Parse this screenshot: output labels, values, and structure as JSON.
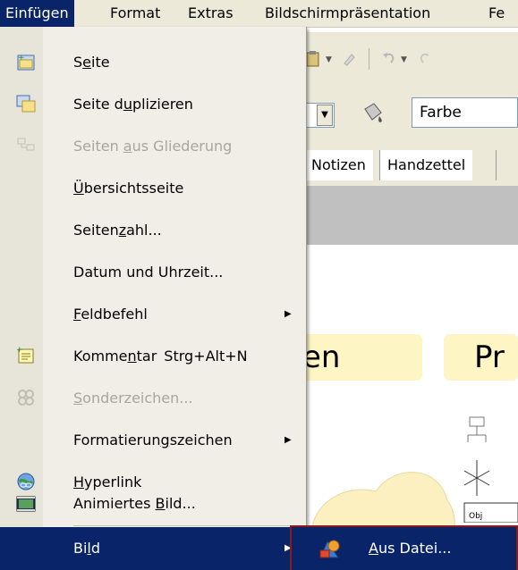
{
  "menubar": {
    "items": [
      {
        "label": "Einfügen",
        "mnemonic": "E"
      },
      {
        "label": "Format",
        "mnemonic": "F"
      },
      {
        "label": "Extras",
        "mnemonic": "x"
      },
      {
        "label": "Bildschirmpräsentation",
        "mnemonic": "p"
      },
      {
        "label": "Fe",
        "mnemonic": ""
      }
    ]
  },
  "menu": {
    "items": [
      {
        "label": "Seite",
        "icon": "new-slide-icon",
        "enabled": true,
        "submenu": false
      },
      {
        "label": "Seite duplizieren",
        "icon": "duplicate-slide-icon",
        "enabled": true,
        "submenu": false
      },
      {
        "label": "Seiten aus Gliederung",
        "icon": "outline-slides-icon",
        "enabled": false,
        "submenu": false
      },
      {
        "label": "Übersichtsseite",
        "icon": "",
        "enabled": true,
        "submenu": false
      },
      {
        "label": "Seitenzahl...",
        "icon": "",
        "enabled": true,
        "submenu": false
      },
      {
        "label": "Datum und Uhrzeit...",
        "icon": "",
        "enabled": true,
        "submenu": false
      },
      {
        "label": "Feldbefehl",
        "icon": "",
        "enabled": true,
        "submenu": true
      },
      {
        "label": "Kommentar",
        "shortcut": "Strg+Alt+N",
        "icon": "comment-icon",
        "enabled": true,
        "submenu": false
      },
      {
        "label": "Sonderzeichen...",
        "icon": "special-character-icon",
        "enabled": false,
        "submenu": false
      },
      {
        "label": "Formatierungszeichen",
        "icon": "",
        "enabled": true,
        "submenu": true
      },
      {
        "label": "Hyperlink",
        "icon": "hyperlink-icon",
        "enabled": true,
        "submenu": false
      },
      {
        "label": "Animiertes Bild...",
        "icon": "animated-image-icon",
        "enabled": true,
        "submenu": false
      },
      {
        "label": "Bild",
        "icon": "",
        "enabled": true,
        "submenu": true,
        "highlighted": true
      }
    ]
  },
  "submenu": {
    "items": [
      {
        "label": "Aus Datei...",
        "icon": "from-file-icon",
        "highlighted": true
      }
    ]
  },
  "background": {
    "toolbar2": {
      "color_field": "Farbe"
    },
    "tabs": [
      "Notizen",
      "Handzettel"
    ],
    "slide_titles": [
      "en",
      "Pr"
    ],
    "diagram_label": "Obj"
  },
  "colors": {
    "menu_bg": "#f0eee6",
    "highlight": "#0a246a",
    "menubar_bg": "#ece9d8",
    "disabled_text": "#a8a69c",
    "slide_title_bg": "#fdf5c4",
    "frame_red": "#8b1a1a"
  }
}
